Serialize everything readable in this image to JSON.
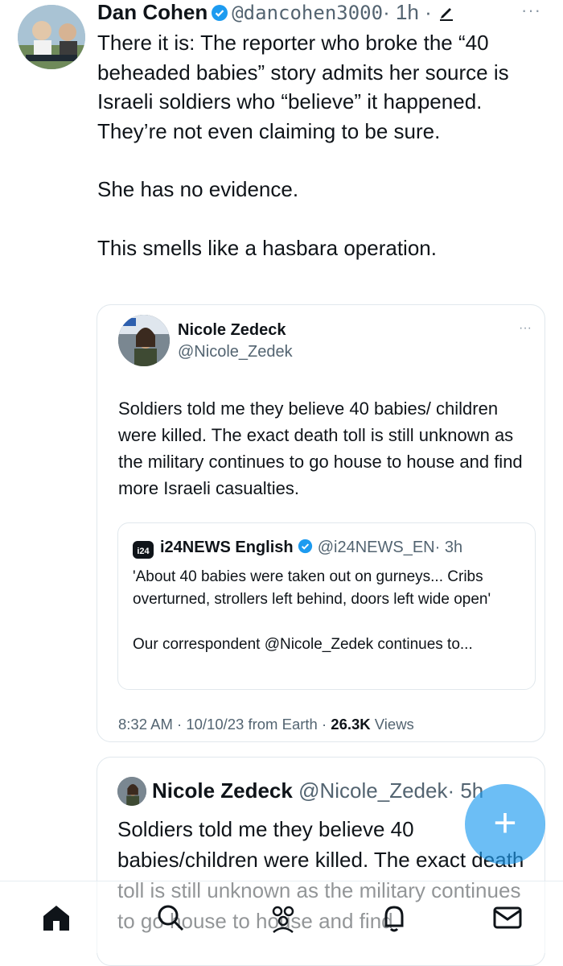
{
  "tweet": {
    "author_name": "Dan Cohen",
    "handle": "@dancohen3000",
    "time": "· 1h ·",
    "more": "···",
    "paragraphs": [
      "There it is: The reporter who broke the “40 beheaded babies” story admits her source is Israeli soldiers who “believe” it happened. They’re not even claiming to be sure.",
      "She has no evidence.",
      "This smells like a hasbara operation."
    ]
  },
  "quote": {
    "author_name": "Nicole Zedeck",
    "handle": "@Nicole_Zedek",
    "more": "···",
    "text": "Soldiers told me they believe 40 babies/ children were killed. The exact death toll is still unknown as the military continues to go house to house and find more Israeli casualties.",
    "inner": {
      "logo": "i24",
      "author_name": "i24NEWS English",
      "handle": "@i24NEWS_EN",
      "time": "· 3h",
      "lines": [
        "'About 40 babies were taken out on gurneys... Cribs overturned, strollers left behind, doors left wide open'",
        "Our correspondent @Nicole_Zedek continues to..."
      ]
    },
    "footer": {
      "time": "8:32 AM · 10/10/23 from Earth ·",
      "views_count": "26.3K",
      "views_label": "Views"
    }
  },
  "tweet2": {
    "author_name": "Nicole Zedeck",
    "handle": "@Nicole_Zedek",
    "time": "· 5h",
    "text": "Soldiers told me they believe 40 babies/children were killed. The exact death toll is still unknown as the military continues to go house to house and find"
  },
  "fab": {
    "label": "+"
  },
  "nav": {
    "items": [
      "home-icon",
      "search-icon",
      "communities-icon",
      "notifications-icon",
      "messages-icon"
    ]
  },
  "colors": {
    "accent": "#1d9bf0",
    "secondary_text": "#536471",
    "border": "#e1e8ed"
  }
}
